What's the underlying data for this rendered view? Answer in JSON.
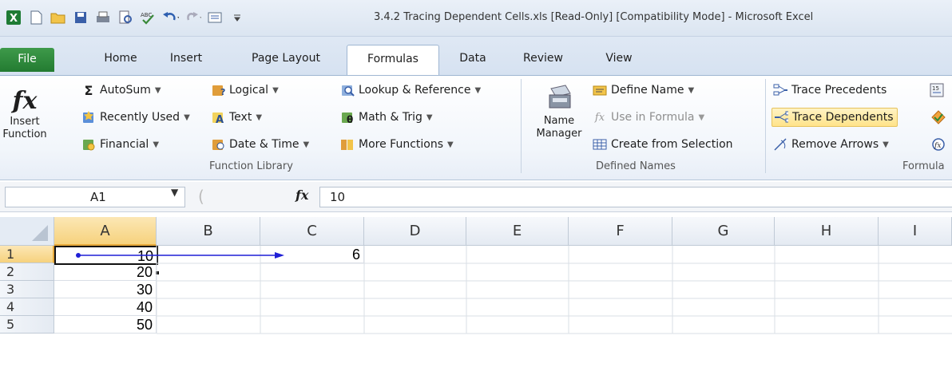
{
  "window": {
    "title": "3.4.2 Tracing Dependent Cells.xls  [Read-Only]  [Compatibility Mode]  -  Microsoft Excel"
  },
  "qat": {
    "icons": [
      "excel-logo-icon",
      "new-icon",
      "open-icon",
      "save-icon",
      "print-icon",
      "print-preview-icon",
      "spelling-icon",
      "undo-icon",
      "redo-icon",
      "form-icon",
      "customize-icon"
    ]
  },
  "tabs": [
    {
      "label": "File"
    },
    {
      "label": "Home"
    },
    {
      "label": "Insert"
    },
    {
      "label": "Page Layout"
    },
    {
      "label": "Formulas"
    },
    {
      "label": "Data"
    },
    {
      "label": "Review"
    },
    {
      "label": "View"
    }
  ],
  "active_tab": "Formulas",
  "ribbon": {
    "function_library": {
      "insert_function_line1": "Insert",
      "insert_function_line2": "Function",
      "autosum": "AutoSum",
      "recently_used": "Recently Used",
      "financial": "Financial",
      "logical": "Logical",
      "text": "Text",
      "date_time": "Date & Time",
      "lookup_reference": "Lookup & Reference",
      "math_trig": "Math & Trig",
      "more_functions": "More Functions",
      "label": "Function Library"
    },
    "defined_names": {
      "name_manager_line1": "Name",
      "name_manager_line2": "Manager",
      "define_name": "Define Name",
      "use_in_formula": "Use in Formula",
      "create_from_selection": "Create from Selection",
      "label": "Defined Names"
    },
    "formula_auditing": {
      "trace_precedents": "Trace Precedents",
      "trace_dependents": "Trace Dependents",
      "remove_arrows": "Remove Arrows",
      "label": "Formula"
    }
  },
  "formula_bar": {
    "name_box": "A1",
    "fx": "fx",
    "value": "10"
  },
  "sheet": {
    "columns": [
      "A",
      "B",
      "C",
      "D",
      "E",
      "F",
      "G",
      "H",
      "I"
    ],
    "rows": [
      "1",
      "2",
      "3",
      "4",
      "5"
    ],
    "active_cell": "A1",
    "cells": {
      "A1": "10",
      "A2": "20",
      "A3": "30",
      "A4": "40",
      "A5": "50",
      "C1": "6"
    },
    "trace_arrow": {
      "from": "A1",
      "to": "C1",
      "color": "#1f1fd6"
    }
  },
  "colors": {
    "file_tab": "#2a8a37",
    "highlight": "#ffe38a",
    "selected_header": "#f6d27d",
    "arrow": "#1f1fd6"
  }
}
